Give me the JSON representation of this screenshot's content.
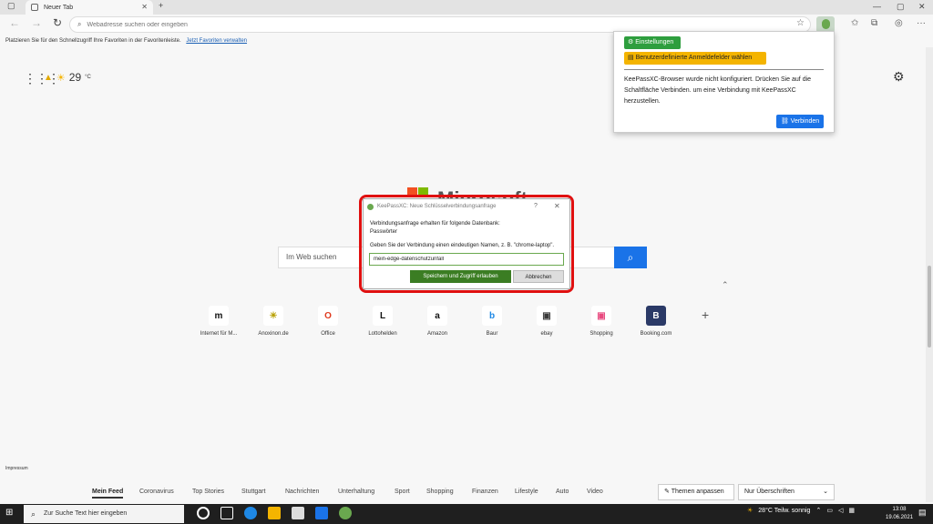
{
  "browser": {
    "tab_title": "Neuer Tab",
    "tab_close": "✕",
    "new_tab": "+",
    "address_placeholder": "Webadresse suchen oder eingeben",
    "favbar_text": "Platzieren Sie für den Schnellzugriff Ihre Favoriten in der Favoritenleiste.",
    "favbar_link": "Jetzt Favoriten verwalten"
  },
  "newtab": {
    "temperature": "29",
    "temp_unit": "°C",
    "brand": "Microsoft",
    "search_placeholder": "Im Web suchen",
    "tiles": [
      {
        "label": "Internet für M...",
        "glyph": "m"
      },
      {
        "label": "Anoxinon.de",
        "glyph": "☀"
      },
      {
        "label": "Office",
        "glyph": "O"
      },
      {
        "label": "Lottohelden",
        "glyph": "L"
      },
      {
        "label": "Amazon",
        "glyph": "a"
      },
      {
        "label": "Baur",
        "glyph": "b"
      },
      {
        "label": "ebay",
        "glyph": "▣"
      },
      {
        "label": "Shopping",
        "glyph": "▣"
      },
      {
        "label": "Booking.com",
        "glyph": "B"
      }
    ],
    "impressum": "Impressum",
    "feed_tabs": [
      "Mein Feed",
      "Coronavirus",
      "Top Stories",
      "Stuttgart",
      "Nachrichten",
      "Unterhaltung",
      "Sport",
      "Shopping",
      "Finanzen",
      "Lifestyle",
      "Auto",
      "Video"
    ],
    "themes_button": "Themen anpassen",
    "headlines_select": "Nur Überschriften"
  },
  "extension_popup": {
    "settings_button": "Einstellungen",
    "fields_button": "Benutzerdefinierte Anmeldefelder wählen",
    "message": "KeePassXC-Browser wurde nicht konfiguriert. Drücken Sie auf die Schaltfläche Verbinden. um eine Verbindung mit KeePassXC herzustellen.",
    "connect_button": "Verbinden"
  },
  "dialog": {
    "title": "KeePassXC: Neue Schlüsselverbindungsanfrage",
    "help": "?",
    "close": "✕",
    "request_text": "Verbindungsanfrage erhalten für folgende Datenbank:",
    "database": "Passwörter",
    "prompt": "Geben Sie der Verbindung einen eindeutigen Namen, z. B. \"chrome-laptop\".",
    "input_value": "mein-edge-datenschutzunfall",
    "save_button": "Speichern und Zugriff erlauben",
    "cancel_button": "Abbrechen"
  },
  "taskbar": {
    "search_placeholder": "Zur Suche Text hier eingeben",
    "weather": "28°C  Teilw. sonnig",
    "time": "13:08",
    "date": "19.06.2021"
  },
  "colors": {
    "accent_blue": "#1a73e8",
    "keepass_green": "#6aa84f",
    "highlight_red": "#e01010",
    "warning_yellow": "#f4b400"
  }
}
